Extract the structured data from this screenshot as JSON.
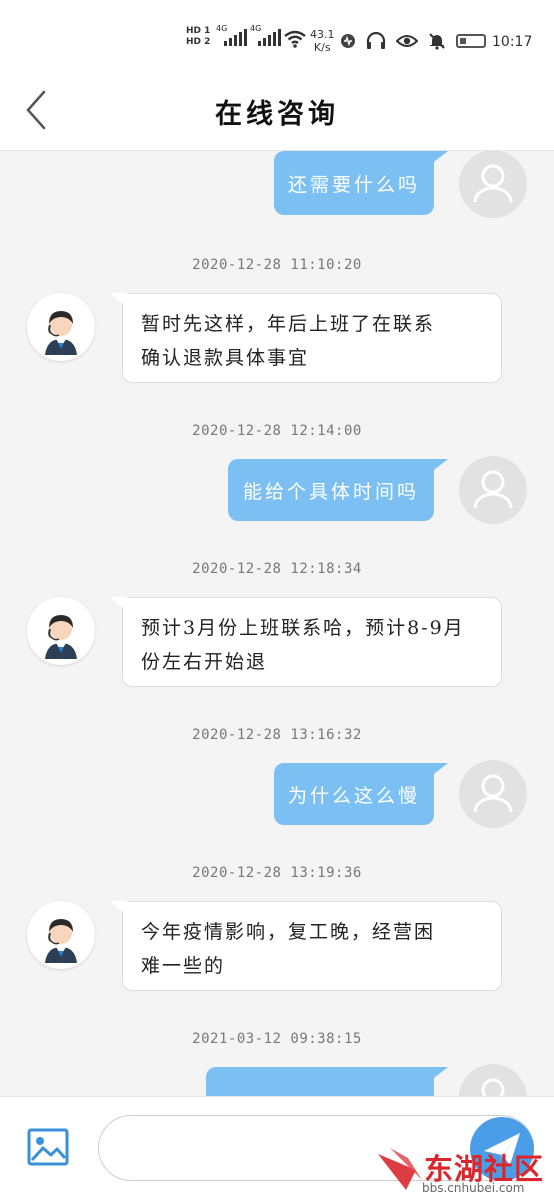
{
  "status_bar": {
    "hd1": "HD 1",
    "hd2": "HD 2",
    "net1": "4G",
    "net2": "4G",
    "speed_value": "43.1",
    "speed_unit": "K/s",
    "time": "10:17",
    "icons": [
      "signal-icon",
      "wifi-icon",
      "data-icon",
      "headphones-icon",
      "eye-icon",
      "mute-bell-icon",
      "battery-icon"
    ]
  },
  "header": {
    "title": "在线咨询"
  },
  "chat": {
    "messages": [
      {
        "type": "out",
        "text": "还需要什么吗"
      },
      {
        "type": "timestamp",
        "text": "2020-12-28 11:10:20"
      },
      {
        "type": "in",
        "lines": [
          "暂时先这样，年后上班了在联系",
          "确认退款具体事宜"
        ]
      },
      {
        "type": "timestamp",
        "text": "2020-12-28 12:14:00"
      },
      {
        "type": "out",
        "text": "能给个具体时间吗"
      },
      {
        "type": "timestamp",
        "text": "2020-12-28 12:18:34"
      },
      {
        "type": "in",
        "lines": [
          "预计3月份上班联系哈，预计8-9月",
          "份左右开始退"
        ]
      },
      {
        "type": "timestamp",
        "text": "2020-12-28 13:16:32"
      },
      {
        "type": "out",
        "text": "为什么这么慢"
      },
      {
        "type": "timestamp",
        "text": "2020-12-28 13:19:36"
      },
      {
        "type": "in",
        "lines": [
          "今年疫情影响，复工晚，经营困",
          "难一些的"
        ]
      },
      {
        "type": "timestamp",
        "text": "2021-03-12 09:38:15"
      },
      {
        "type": "out",
        "text": ""
      }
    ]
  },
  "input_bar": {
    "placeholder": ""
  },
  "watermark": {
    "name": "东湖社区",
    "url": "bbs.cnhubei.com"
  },
  "colors": {
    "outgoing_bubble": "#7cc0f3",
    "send_button": "#4a9ee8",
    "watermark_red": "#d9272d"
  }
}
